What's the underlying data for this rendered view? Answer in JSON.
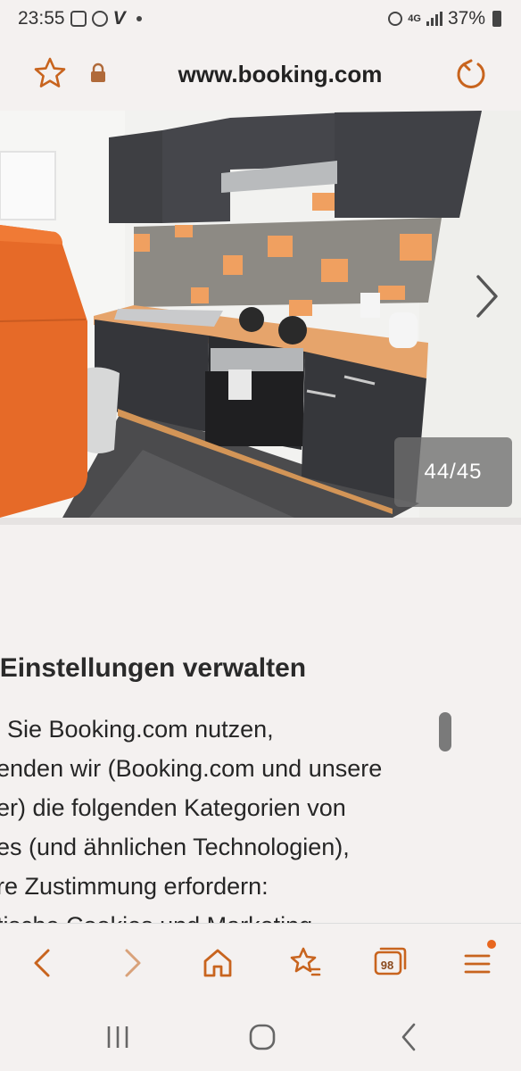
{
  "status_bar": {
    "time": "23:55",
    "indicator": "V",
    "network": "4G",
    "battery": "37%",
    "icons": [
      "gallery-icon",
      "viber-icon",
      "alarm-icon",
      "signal-icon",
      "battery-icon"
    ]
  },
  "browser": {
    "url": "www.booking.com",
    "accent_color": "#c8641e"
  },
  "gallery": {
    "counter": "44/45"
  },
  "cookie_notice": {
    "heading": "kie-Einstellungen verwalten",
    "lines": [
      "Sie Booking.com nutzen,",
      "enden wir (Booking.com und unsere",
      "er) die folgenden Kategorien von",
      "es (und ähnlichen Technologien),",
      "re Zustimmung erfordern:",
      "tische Cookies und Marketing"
    ]
  },
  "toolbar": {
    "tabs_count": "98"
  }
}
